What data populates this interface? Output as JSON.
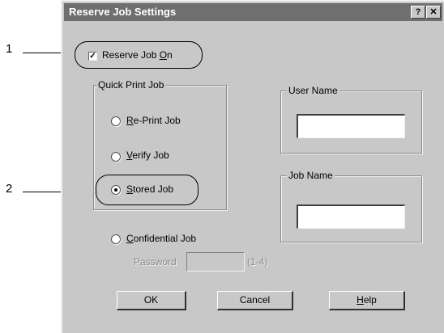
{
  "callouts": {
    "one": "1",
    "two": "2"
  },
  "window": {
    "title": "Reserve Job Settings",
    "help_label": "?",
    "close_label": "✕"
  },
  "reserve": {
    "checked": true,
    "check_mark": "✓",
    "label_prefix": "Reserve Job ",
    "label_accel": "O",
    "label_suffix": "n"
  },
  "quick_print": {
    "group_label": "Quick Print Job",
    "options": [
      {
        "accel": "R",
        "rest": "e-Print Job",
        "selected": false
      },
      {
        "accel": "V",
        "rest": "erify Job",
        "selected": false
      },
      {
        "accel": "S",
        "rest": "tored Job",
        "selected": true
      }
    ]
  },
  "confidential": {
    "accel": "C",
    "rest": "onfidential Job",
    "selected": false,
    "password_label": "Password",
    "password_value": "",
    "password_hint": "(1-4)"
  },
  "user_name": {
    "group_label": "User Name",
    "value": ""
  },
  "job_name": {
    "group_label": "Job Name",
    "value": ""
  },
  "buttons": {
    "ok": "OK",
    "cancel": "Cancel",
    "help_accel": "H",
    "help_rest": "elp"
  }
}
